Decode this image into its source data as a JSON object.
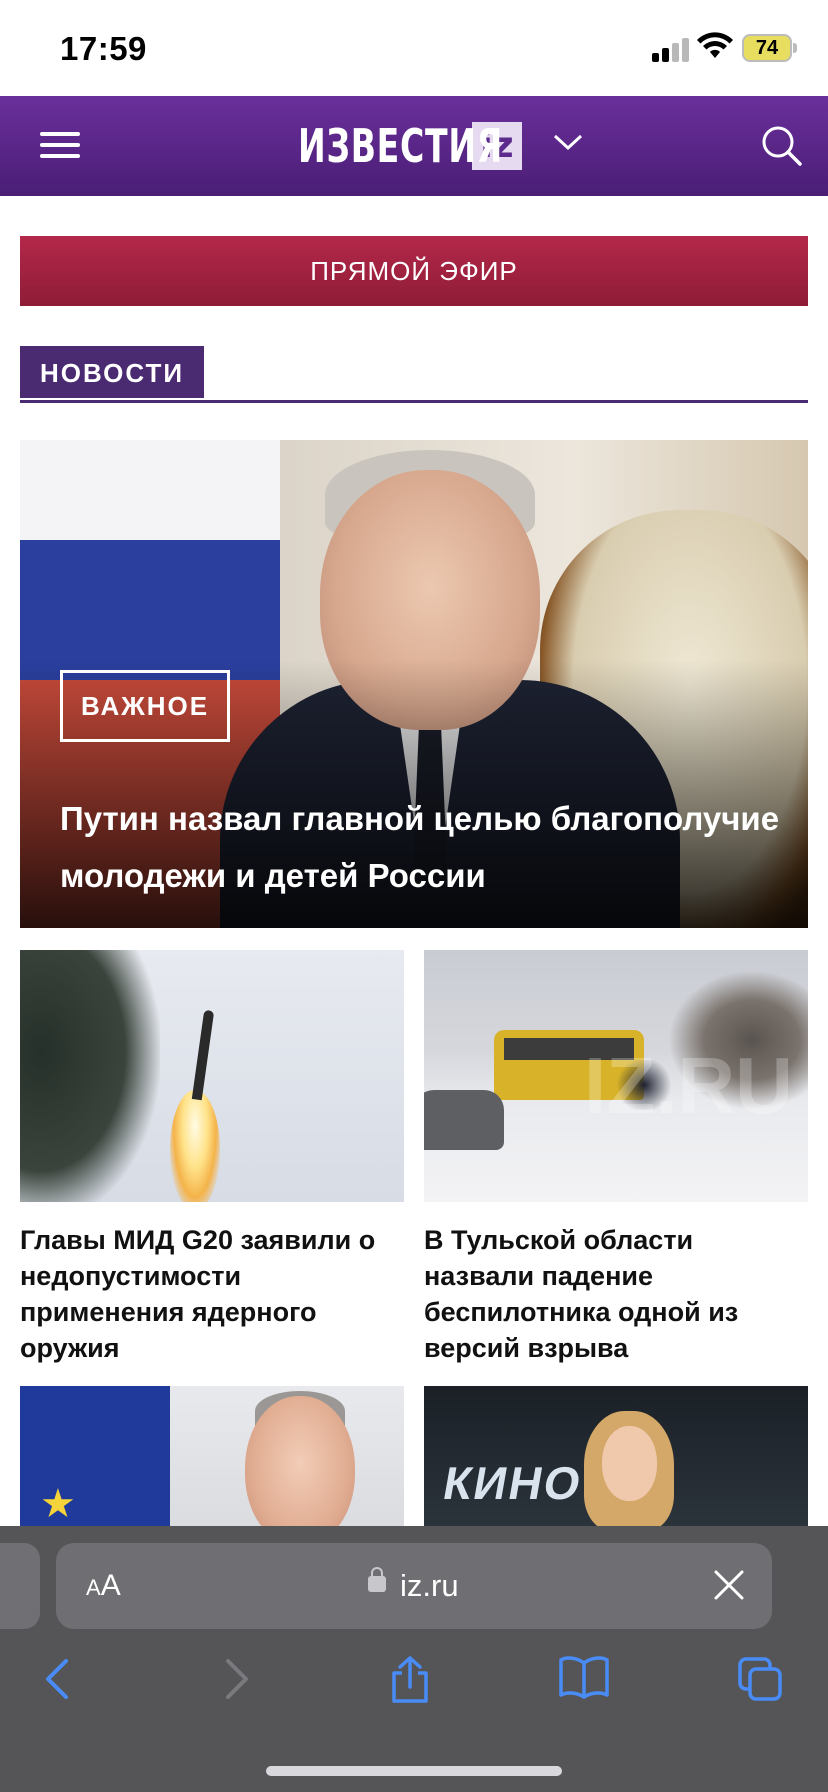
{
  "status_bar": {
    "time": "17:59",
    "battery": "74"
  },
  "header": {
    "logo_text": "ИЗВЕСТИЯ",
    "logo_badge": "iz"
  },
  "live_button": {
    "label": "ПРЯМОЙ ЭФИР"
  },
  "section": {
    "title": "НОВОСТИ"
  },
  "hero": {
    "badge": "ВАЖНОЕ",
    "title": "Путин назвал главной целью благополучие молодежи и детей России"
  },
  "cards": [
    {
      "title": "Главы МИД G20 заявили о недопустимости применения ядерного оружия"
    },
    {
      "title": "В Тульской области назвали падение беспилотника одной из версий взрыва",
      "image_watermark": "IZ.RU"
    },
    {
      "title": ""
    },
    {
      "title": "",
      "image_text": "КИНО"
    }
  ],
  "browser": {
    "text_size_label": "AA",
    "url": "iz.ru"
  },
  "icons": {
    "menu": "hamburger-menu-icon",
    "chevron": "chevron-down-icon",
    "search": "search-icon",
    "close": "close-icon",
    "back": "back-arrow-icon",
    "forward": "forward-arrow-icon",
    "share": "share-icon",
    "bookmarks": "bookmarks-icon",
    "tabs": "tabs-icon"
  },
  "colors": {
    "header_purple": "#5b2a8c",
    "live_red": "#a8223f",
    "section_purple": "#4a2a70",
    "safari_gray": "#555558",
    "link_blue": "#4a8cf7"
  }
}
